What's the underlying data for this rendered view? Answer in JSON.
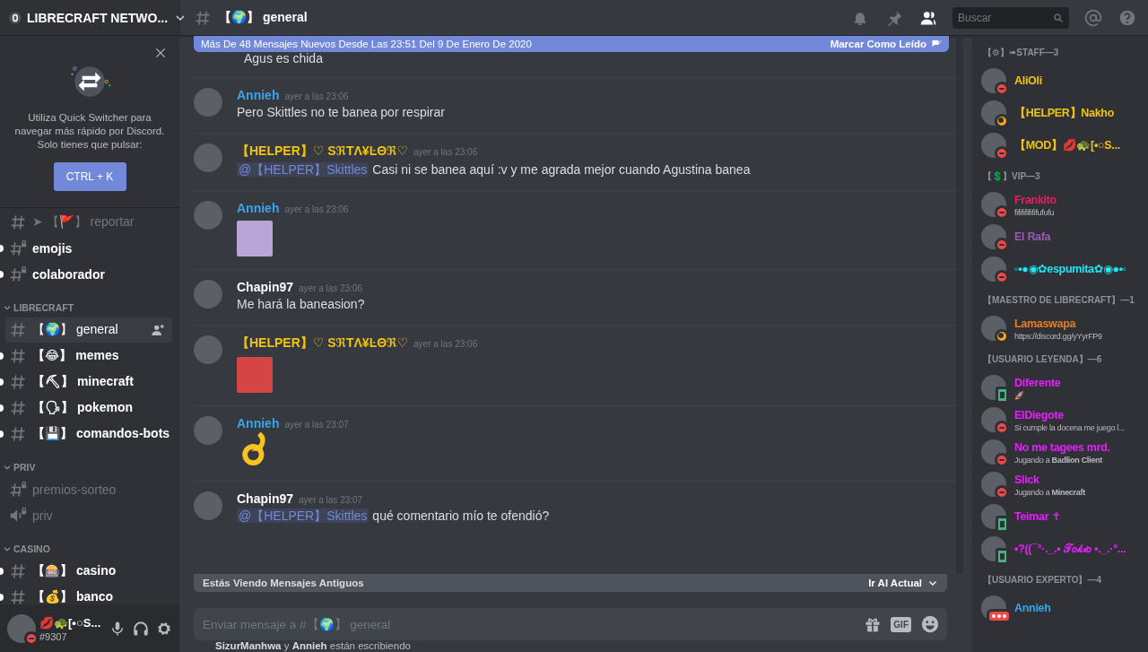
{
  "server": {
    "name": "LIBRECRAFT NETWO..."
  },
  "quick_switcher": {
    "text": "Utiliza Quick Switcher para navegar más rápido por Discord. Solo tienes que pulsar:",
    "shortcut": "CTRL + K"
  },
  "uncategorized": [
    {
      "kind": "text",
      "name": "➤ 【🚩】 reportar",
      "locked": false,
      "unread": false,
      "selected": false
    },
    {
      "kind": "text",
      "name": "emojis",
      "locked": true,
      "unread": true,
      "selected": false
    },
    {
      "kind": "text",
      "name": "colaborador",
      "locked": true,
      "unread": true,
      "selected": false
    }
  ],
  "categories": [
    {
      "name": "LIBRECRAFT",
      "expanded": true,
      "channels": [
        {
          "kind": "text",
          "name": "【🌍】 general",
          "locked": false,
          "unread": false,
          "selected": true
        },
        {
          "kind": "text",
          "name": "【😂】 memes",
          "locked": false,
          "unread": true,
          "selected": false
        },
        {
          "kind": "text",
          "name": "【⛏】 minecraft",
          "locked": false,
          "unread": true,
          "selected": false
        },
        {
          "kind": "text",
          "name": "【🗣】 pokemon",
          "locked": false,
          "unread": true,
          "selected": false
        },
        {
          "kind": "text",
          "name": "【💾】 comandos-bots",
          "locked": false,
          "unread": true,
          "selected": false
        }
      ]
    },
    {
      "name": "PRIV",
      "expanded": true,
      "channels": [
        {
          "kind": "text",
          "name": "premios-sorteo",
          "locked": true,
          "unread": false,
          "selected": false
        },
        {
          "kind": "voice",
          "name": "priv",
          "locked": true,
          "unread": false,
          "selected": false
        }
      ]
    },
    {
      "name": "CASINO",
      "expanded": true,
      "channels": [
        {
          "kind": "text",
          "name": "【🎰】 casino",
          "locked": false,
          "unread": true,
          "selected": false
        },
        {
          "kind": "text",
          "name": "【💰】 banco",
          "locked": false,
          "unread": true,
          "selected": false
        }
      ]
    }
  ],
  "user_panel": {
    "name": "💋🐢[•○S...",
    "tag": "#9307",
    "kind": "dnd"
  },
  "chat_header": {
    "channel": "【🌍】 general",
    "search_placeholder": "Buscar"
  },
  "new_messages_bar": {
    "text": "Más De 48 Mensajes Nuevos Desde Las 23:51 Del 9 De Enero De 2020",
    "action": "Marcar Como Leído"
  },
  "messages": [
    {
      "kind": "continuation",
      "text": "Agus es chida"
    },
    {
      "kind": "text",
      "author": "Annieh",
      "color": "#3ca4e8",
      "time": "ayer a las 23:06",
      "text": "Pero Skittles no te banea por respirar"
    },
    {
      "kind": "text",
      "author": "【HELPER】♡ SℜTΛ¥ĿΘℜ♡",
      "color": "#f1c40f",
      "time": "ayer a las 23:06",
      "mention": "@【HELPER】Skittles",
      "text": "Casi ni se banea aquí :v y me agrada mejor cuando Agustina banea"
    },
    {
      "kind": "sticker",
      "author": "Annieh",
      "color": "#3ca4e8",
      "time": "ayer a las 23:06"
    },
    {
      "kind": "text",
      "author": "Chapin97",
      "color": "#ffffff",
      "time": "ayer a las 23:06",
      "text": "Me hará la baneasion?"
    },
    {
      "kind": "image",
      "author": "【HELPER】♡ SℜTΛ¥ĿΘℜ♡",
      "color": "#f1c40f",
      "time": "ayer a las 23:06"
    },
    {
      "kind": "emoji",
      "author": "Annieh",
      "color": "#3ca4e8",
      "time": "ayer a las 23:07"
    },
    {
      "kind": "text",
      "author": "Chapin97",
      "color": "#ffffff",
      "time": "ayer a las 23:07",
      "mention": "@【HELPER】Skittles",
      "text": "qué comentario mío te ofendió?"
    }
  ],
  "old_messages_bar": {
    "text": "Estás Viendo Mensajes Antiguos",
    "action": "Ir Al Actual"
  },
  "composer": {
    "placeholder": "Enviar mensaje a #【🌍】 general",
    "gif": "GIF"
  },
  "typing": "**SizurManhwa** y **Annieh** están escribiendo",
  "member_groups": [
    {
      "title": "【⚙】➠STAFF—3",
      "members": [
        {
          "name": "AliOli",
          "color": "#f1c40f",
          "kind": "dnd"
        },
        {
          "name": "【HELPER】Nakho",
          "color": "#f1c40f",
          "kind": "idle"
        },
        {
          "name": "【MOD】💋🐢[•○S...",
          "color": "#f1c40f",
          "kind": "dnd"
        }
      ]
    },
    {
      "title": "【💲】VIP—3",
      "members": [
        {
          "name": "Frankito",
          "color": "#e91e63",
          "kind": "dnd",
          "activity": "fififififififufufu"
        },
        {
          "name": "El Rafa",
          "color": "#9b59b6",
          "kind": "dnd"
        },
        {
          "name": "◦•●◉✿espumita✿◉●•◦",
          "color": "#1de9f6",
          "kind": "dnd"
        }
      ]
    },
    {
      "title": "【MAESTRO DE LIBRECRAFT】—1",
      "members": [
        {
          "name": "Lamaswapa",
          "color": "#e67e22",
          "kind": "idle",
          "activity": "https://discord.gg/yYyrFP9"
        }
      ]
    },
    {
      "title": "【USUARIO LEYENDA】—6",
      "members": [
        {
          "name": "Diferente",
          "color": "#e91eff",
          "kind": "mobile",
          "activity": "🚀"
        },
        {
          "name": "ElDiegote",
          "color": "#e91eff",
          "kind": "dnd",
          "activity": "Si cumple la docena me juego l..."
        },
        {
          "name": "No me tagees mrd.",
          "color": "#e91eff",
          "kind": "dnd",
          "activity": "Jugando a **Badlion Client**"
        },
        {
          "name": "Slick",
          "color": "#e91eff",
          "kind": "dnd",
          "activity": "Jugando a **Minecraft**"
        },
        {
          "name": "Teimar ✝",
          "color": "#e91eff",
          "kind": "mobile"
        },
        {
          "name": "•?((¯°·._.• 𝒯𝑜𝓀𝒾𝑜 •._.·°...",
          "color": "#e91eff",
          "kind": "mobile"
        }
      ]
    },
    {
      "title": "【USUARIO EXPERTO】—4",
      "members": [
        {
          "name": "Annieh",
          "color": "#3ca4e8",
          "kind": "typing"
        }
      ]
    }
  ]
}
